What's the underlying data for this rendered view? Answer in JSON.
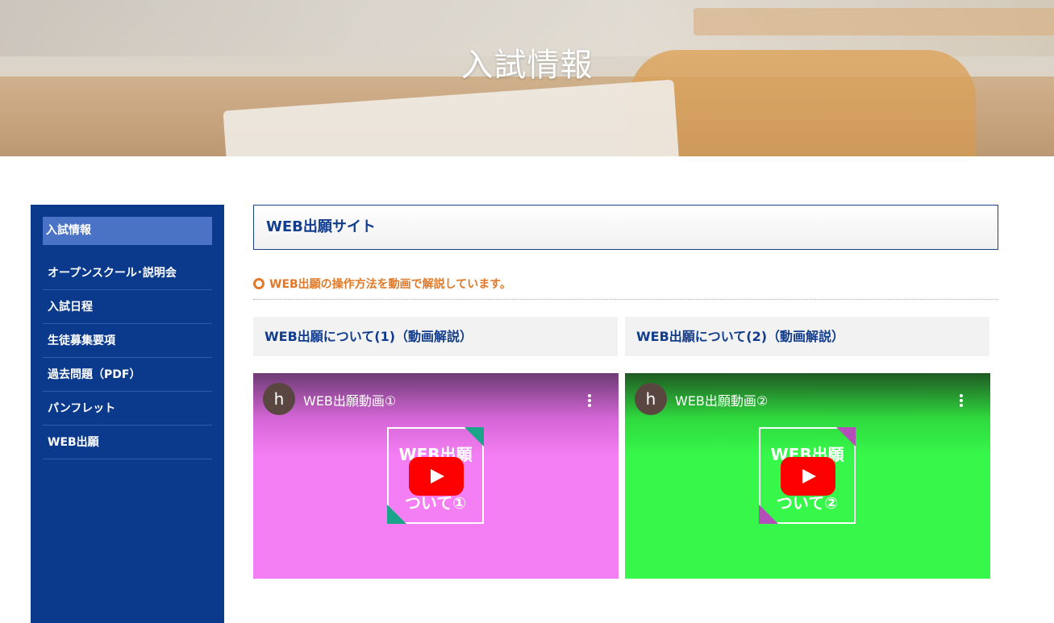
{
  "hero": {
    "title": "入試情報"
  },
  "sidebar": {
    "active": "入試情報",
    "items": [
      {
        "label": "オープンスクール･説明会"
      },
      {
        "label": "入試日程"
      },
      {
        "label": "生徒募集要項"
      },
      {
        "label": "過去問題（PDF）"
      },
      {
        "label": "パンフレット"
      },
      {
        "label": "WEB出願"
      }
    ]
  },
  "main": {
    "heading": "WEB出願サイト",
    "intro": "WEB出願の操作方法を動画で解説しています。",
    "videos": [
      {
        "heading": "WEB出願について(1)（動画解説）",
        "channel_initial": "h",
        "title": "WEB出願動画①",
        "thumb_line1": "WEB出願",
        "thumb_line2": "ついて①"
      },
      {
        "heading": "WEB出願について(2)（動画解説）",
        "channel_initial": "h",
        "title": "WEB出願動画②",
        "thumb_line1": "WEB出願",
        "thumb_line2": "ついて②"
      }
    ]
  },
  "colors": {
    "sidebar": "#0b3a8c",
    "active": "#4a72c5",
    "heading": "#123c8c",
    "accent": "#e07a2a",
    "video1": "#f47ef3",
    "video2": "#37f74a"
  }
}
